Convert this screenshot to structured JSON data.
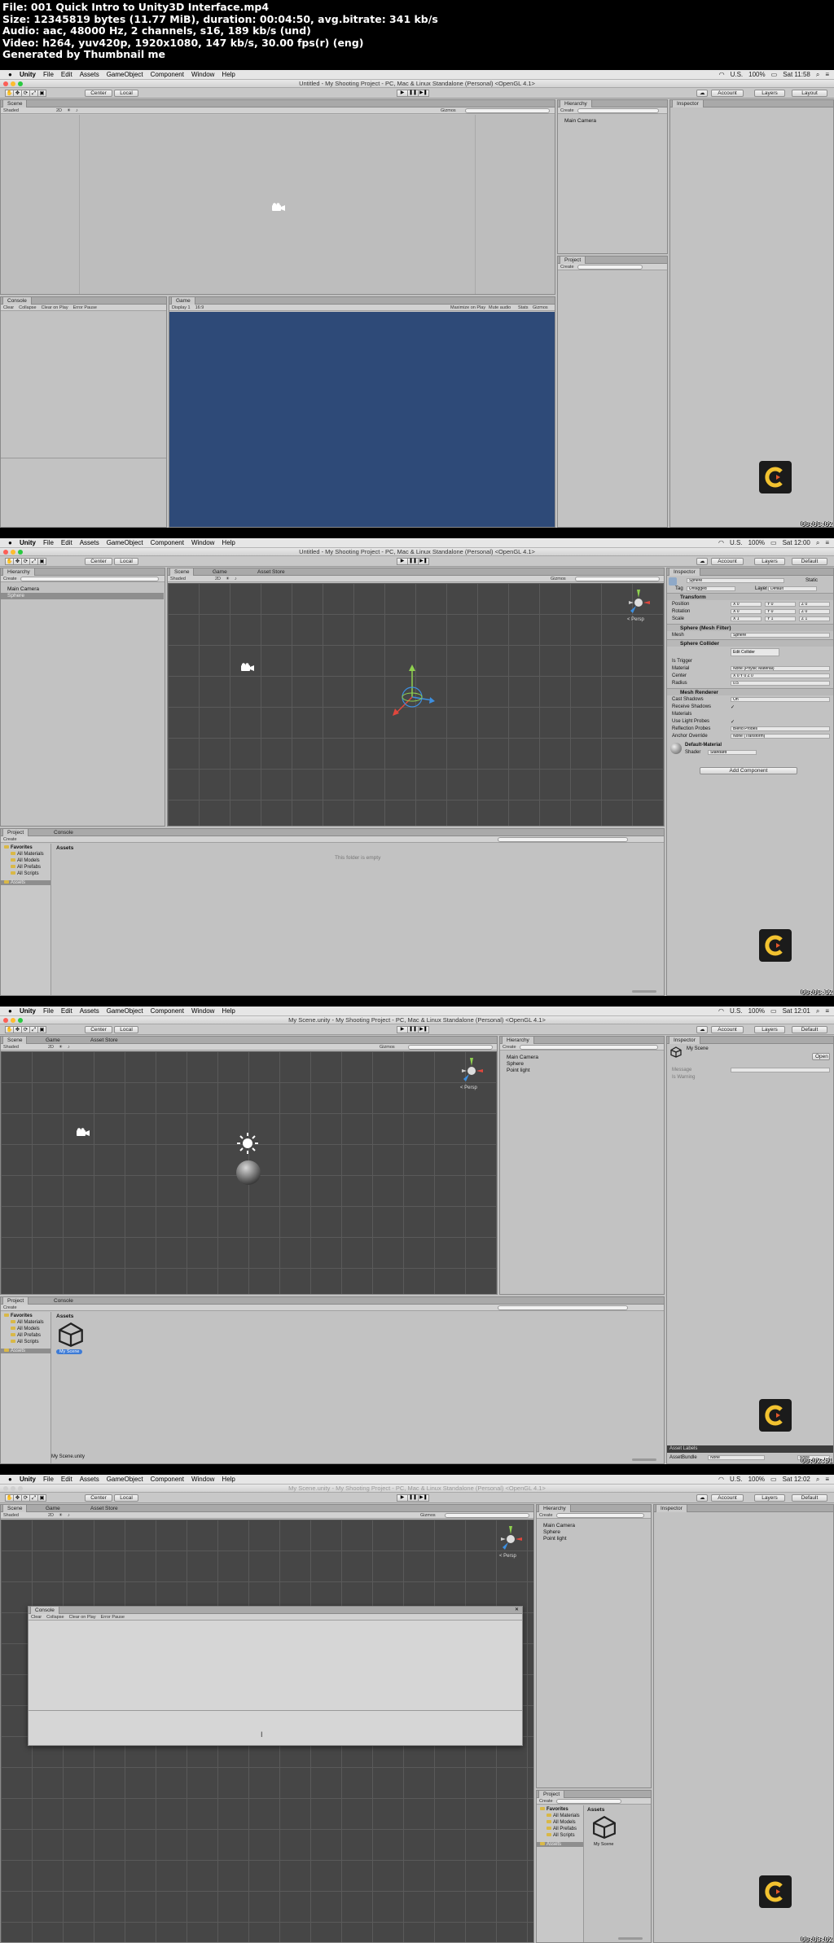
{
  "sheet": {
    "lines": [
      "File: 001 Quick Intro to Unity3D Interface.mp4",
      "Size: 12345819 bytes (11.77 MiB), duration: 00:04:50, avg.bitrate: 341 kb/s",
      "Audio: aac, 48000 Hz, 2 channels, s16, 189 kb/s (und)",
      "Video: h264, yuv420p, 1920x1080, 147 kb/s, 30.00 fps(r) (eng)",
      "Generated by Thumbnail me"
    ]
  },
  "menubar": {
    "apple": "",
    "items": [
      "Unity",
      "File",
      "Edit",
      "Assets",
      "GameObject",
      "Component",
      "Window",
      "Help"
    ],
    "status": [
      "U.S.",
      "100%"
    ]
  },
  "toolbar": {
    "tools": [
      "✋",
      "✥",
      "⟳",
      "⤢",
      "▣"
    ],
    "center_label": "Center",
    "local_label": "Local",
    "account_label": "Account",
    "layers_label": "Layers",
    "play_icons": [
      "▶",
      "❚❚",
      "▶❚"
    ]
  },
  "frames": [
    {
      "timestamp": "00:01:02",
      "window_title": "Untitled - My Shooting Project - PC, Mac & Linux Standalone (Personal) <OpenGL 4.1>",
      "clock": "Sat 11:58",
      "layout_label": "Layout",
      "scene_tab": "Scene",
      "scene_shading": "Shaded",
      "scene_2d": "2D",
      "gizmos_label": "Gizmos",
      "hierarchy_tab": "Hierarchy",
      "hierarchy_create": "Create",
      "hierarchy_items": [
        "Main Camera"
      ],
      "project_tab": "Project",
      "project_create": "Create",
      "inspector_tab": "Inspector",
      "console_tab": "Console",
      "console_buttons": [
        "Clear",
        "Collapse",
        "Clear on Play",
        "Error Pause"
      ],
      "game_tab": "Game",
      "game_display": "Display 1",
      "game_aspect": "16:9",
      "game_buttons": [
        "Maximize on Play",
        "Mute audio",
        "Stats",
        "Gizmos"
      ],
      "game_bg": "#2e4a78"
    },
    {
      "timestamp": "00:01:12",
      "window_title": "Untitled - My Shooting Project - PC, Mac & Linux Standalone (Personal) <OpenGL 4.1>",
      "clock": "Sat 12:00",
      "layout_label": "Default",
      "hierarchy_tab": "Hierarchy",
      "hierarchy_create": "Create",
      "hierarchy_items": [
        "Main Camera",
        "Sphere"
      ],
      "scene_tabs": [
        "Scene",
        "Game",
        "Asset Store"
      ],
      "scene_shading": "Shaded",
      "scene_2d": "2D",
      "gizmos_label": "Gizmos",
      "persp_label": "< Persp",
      "inspector_tab": "Inspector",
      "object_name": "Sphere",
      "static_label": "Static",
      "tag_label": "Tag",
      "tag_value": "Untagged",
      "layer_label": "Layer",
      "layer_value": "Default",
      "transform_title": "Transform",
      "transform_rows": [
        {
          "label": "Position",
          "x": "X 0",
          "y": "Y 0",
          "z": "Z 0"
        },
        {
          "label": "Rotation",
          "x": "X 0",
          "y": "Y 0",
          "z": "Z 0"
        },
        {
          "label": "Scale",
          "x": "X 1",
          "y": "Y 1",
          "z": "Z 1"
        }
      ],
      "mesh_filter_title": "Sphere (Mesh Filter)",
      "mesh_label": "Mesh",
      "mesh_value": "Sphere",
      "collider_title": "Sphere Collider",
      "edit_collider": "Edit Collider",
      "collider_rows": [
        {
          "label": "Is Trigger",
          "value": ""
        },
        {
          "label": "Material",
          "value": "None (Physic Material)"
        },
        {
          "label": "Center",
          "value": "X 0    Y 0    Z 0"
        },
        {
          "label": "Radius",
          "value": "0.5"
        }
      ],
      "renderer_title": "Mesh Renderer",
      "renderer_rows": [
        {
          "label": "Cast Shadows",
          "value": "On"
        },
        {
          "label": "Receive Shadows",
          "value": "✓"
        },
        {
          "label": "Materials",
          "value": ""
        },
        {
          "label": "Use Light Probes",
          "value": "✓"
        },
        {
          "label": "Reflection Probes",
          "value": "Blend Probes"
        },
        {
          "label": "Anchor Override",
          "value": "None (Transform)"
        }
      ],
      "material_name": "Default-Material",
      "shader_label": "Shader",
      "shader_value": "Standard",
      "add_component": "Add Component",
      "project_tabs": [
        "Project",
        "Console"
      ],
      "project_create": "Create",
      "favorites_label": "Favorites",
      "favorites": [
        "All Materials",
        "All Models",
        "All Prefabs",
        "All Scripts"
      ],
      "assets_label": "Assets",
      "assets_header": "Assets",
      "empty_text": "This folder is empty"
    },
    {
      "timestamp": "00:02:51",
      "window_title": "My Scene.unity - My Shooting Project - PC, Mac & Linux Standalone (Personal) <OpenGL 4.1>",
      "clock": "Sat 12:01",
      "layout_label": "Default",
      "scene_tabs": [
        "Scene",
        "Game",
        "Asset Store"
      ],
      "scene_shading": "Shaded",
      "scene_2d": "2D",
      "gizmos_label": "Gizmos",
      "persp_label": "< Persp",
      "hierarchy_tab": "Hierarchy",
      "hierarchy_create": "Create",
      "hierarchy_items": [
        "Main Camera",
        "Sphere",
        "Point light"
      ],
      "inspector_tab": "Inspector",
      "scene_asset_name": "My Scene",
      "open_label": "Open",
      "insp_rows": [
        "Message",
        "Is Warning"
      ],
      "asset_labels": "Asset Labels",
      "assetbundle_label": "AssetBundle",
      "assetbundle_value": "None",
      "assetbundle_variant": "None",
      "project_tabs": [
        "Project",
        "Console"
      ],
      "project_create": "Create",
      "favorites_label": "Favorites",
      "favorites": [
        "All Materials",
        "All Models",
        "All Prefabs",
        "All Scripts"
      ],
      "assets_label": "Assets",
      "assets_header": "Assets",
      "asset_item": "My Scene",
      "status_file": "My Scene.unity"
    },
    {
      "timestamp": "00:03:02",
      "window_title": "My Scene.unity - My Shooting Project - PC, Mac & Linux Standalone (Personal) <OpenGL 4.1>",
      "clock": "Sat 12:02",
      "layout_label": "Default",
      "scene_tabs": [
        "Scene",
        "Game",
        "Asset Store"
      ],
      "scene_shading": "Shaded",
      "scene_2d": "2D",
      "gizmos_label": "Gizmos",
      "persp_label": "< Persp",
      "console_tab": "Console",
      "console_buttons": [
        "Clear",
        "Collapse",
        "Clear on Play",
        "Error Pause"
      ],
      "hierarchy_tab": "Hierarchy",
      "hierarchy_create": "Create",
      "hierarchy_items": [
        "Main Camera",
        "Sphere",
        "Point light"
      ],
      "inspector_tab": "Inspector",
      "project_tab": "Project",
      "project_create": "Create",
      "favorites_label": "Favorites",
      "favorites": [
        "All Materials",
        "All Models",
        "All Prefabs",
        "All Scripts"
      ],
      "assets_label": "Assets",
      "assets_header": "Assets",
      "asset_item": "My Scene"
    }
  ],
  "colors": {
    "scene_dark": "#484848",
    "panel_gray": "#c2c2c2",
    "selection_blue": "#3d7bd6",
    "logo_yellow": "#f2c230",
    "logo_orange": "#e5572a"
  },
  "icons": [
    "apple-icon",
    "wifi-icon",
    "battery-icon",
    "camera-gizmo-icon",
    "light-gizmo-icon",
    "scene-orientation-gizmo",
    "unity-scene-asset-icon",
    "course-logo",
    "folder-icon"
  ]
}
